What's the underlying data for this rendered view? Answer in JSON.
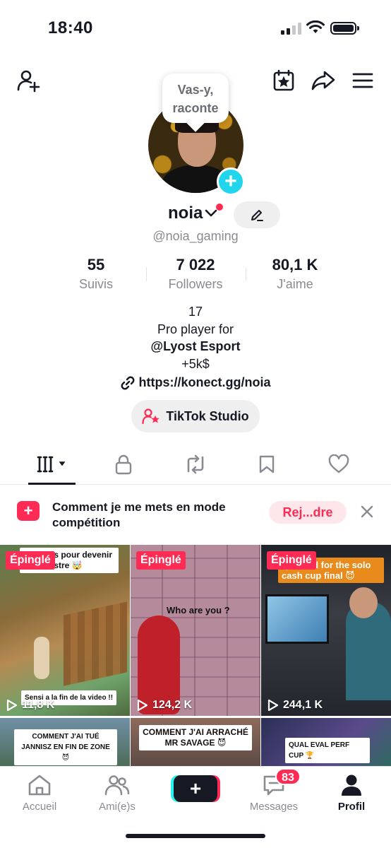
{
  "status": {
    "time": "18:40"
  },
  "bubble": {
    "line1": "Vas-y,",
    "line2": "raconte"
  },
  "profile": {
    "username": "noia",
    "handle": "@noia_gaming",
    "stats": [
      {
        "value": "55",
        "label": "Suivis"
      },
      {
        "value": "7 022",
        "label": "Followers"
      },
      {
        "value": "80,1 K",
        "label": "J'aime"
      }
    ],
    "bio": [
      "17",
      "Pro player for",
      "@Lyost Esport",
      "+5k$"
    ],
    "link": "https://konect.gg/noia",
    "studio_label": "TikTok Studio"
  },
  "banner": {
    "text": "Comment je me mets en mode compétition",
    "join_label": "Rej...dre"
  },
  "videos": [
    {
      "pinned": "Épinglé",
      "caption": "parfaites pour devenir un monstre 🤯",
      "subcaption": "Sensi a la fin de la video !!",
      "views": "11,8 K"
    },
    {
      "pinned": "Épinglé",
      "caption": "Who are you ?",
      "subcaption": "",
      "views": "124,2 K"
    },
    {
      "pinned": "Épinglé",
      "caption": "Qualifed for the solo cash cup final 😈",
      "subcaption": "",
      "views": "244,1 K"
    },
    {
      "pinned": "",
      "caption": "COMMENT J'AI TUÉ JANNISZ EN FIN DE ZONE 😈",
      "subcaption": "",
      "views": ""
    },
    {
      "pinned": "",
      "caption": "COMMENT J'AI ARRACHÉ MR SAVAGE 😈",
      "subcaption": "",
      "views": ""
    },
    {
      "pinned": "",
      "caption": "QUAL EVAL PERF CUP 🏆",
      "subcaption": "",
      "views": ""
    }
  ],
  "nav": {
    "home": "Accueil",
    "friends": "Ami(e)s",
    "messages": "Messages",
    "messages_badge": "83",
    "profile": "Profil"
  },
  "colors": {
    "accent": "#fe2c55",
    "cyan": "#20d5ec"
  }
}
